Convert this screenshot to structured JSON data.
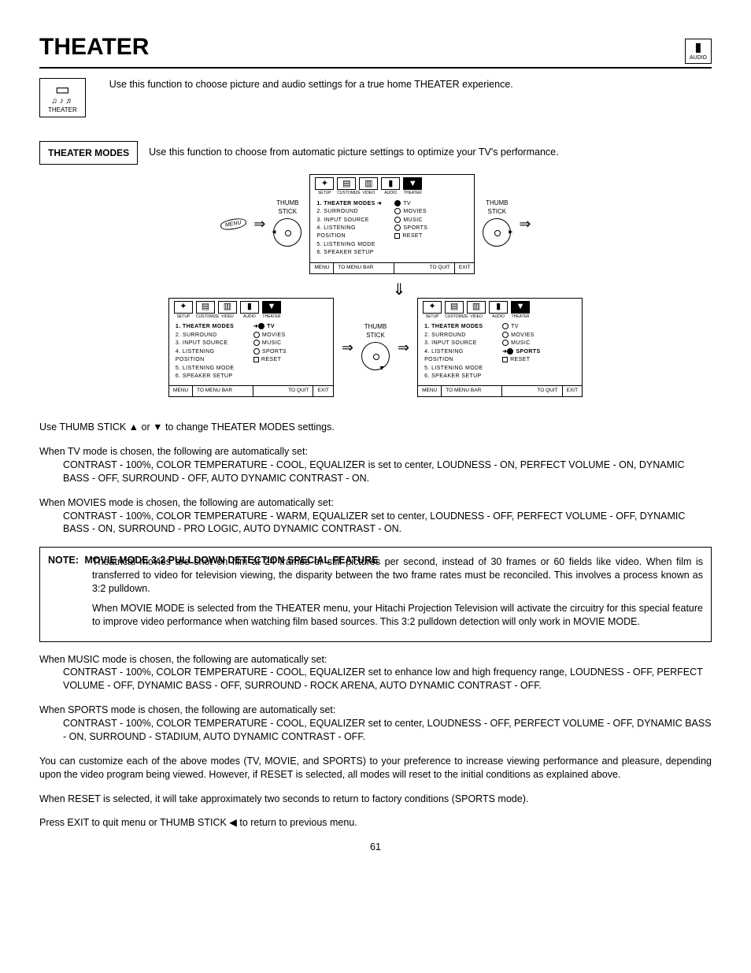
{
  "title": "THEATER",
  "audio_label": "AUDIO",
  "icon_label": "THEATER",
  "intro_text": "Use this function to choose picture and audio settings for a true home THEATER experience.",
  "modes_label": "THEATER MODES",
  "modes_text": "Use this function to choose from automatic picture settings to optimize your TV's performance.",
  "thumb_stick": "THUMB\nSTICK",
  "menu_btn": "MENU",
  "osd": {
    "icons": [
      "SETUP",
      "CUSTOMIZE",
      "VIDEO",
      "AUDIO",
      "THEATER"
    ],
    "items": [
      "1. THEATER MODES",
      "2. SURROUND",
      "3. INPUT SOURCE",
      "4. LISTENING",
      "    POSITION",
      "5. LISTENING MODE",
      "6. SPEAKER SETUP"
    ],
    "opts": [
      "TV",
      "MOVIES",
      "MUSIC",
      "SPORTS",
      "RESET"
    ],
    "foot_menu": "MENU",
    "foot_bar": "TO MENU BAR",
    "foot_quit": "TO QUIT",
    "foot_exit": "EXIT"
  },
  "body1": "Use THUMB STICK ▲ or ▼ to change THEATER MODES settings.",
  "tv_intro": "When TV mode is chosen, the following are automatically set:",
  "tv_detail": "CONTRAST - 100%, COLOR TEMPERATURE - COOL, EQUALIZER is set to center, LOUDNESS - ON, PERFECT VOLUME - ON, DYNAMIC BASS - OFF, SURROUND  - OFF, AUTO DYNAMIC CONTRAST - ON.",
  "movies_intro": "When MOVIES mode is chosen, the following are automatically set:",
  "movies_detail": "CONTRAST - 100%, COLOR TEMPERATURE - WARM, EQUALIZER set to center, LOUDNESS - OFF, PERFECT VOLUME - OFF, DYNAMIC BASS - ON, SURROUND - PRO LOGIC, AUTO DYNAMIC CONTRAST - ON.",
  "note_label": "NOTE:",
  "note_title": "MOVIE MODE 3:2 PULLDOWN DETECTION SPECIAL FEATURE",
  "note_p1": "Theatrical movies are shot on film at 24 frames or still pictures per second, instead of 30 frames or 60 fields like video.  When film is transferred to video for television viewing, the disparity between the two frame rates must be reconciled.  This involves a process known as 3:2 pulldown.",
  "note_p2": "When MOVIE MODE is selected from the THEATER menu, your Hitachi Projection Television will activate the circuitry for this special feature to improve video performance when watching film based sources.  This 3:2 pulldown detection will only work in MOVIE MODE.",
  "music_intro": "When MUSIC mode is chosen, the following are automatically set:",
  "music_detail": "CONTRAST - 100%, COLOR TEMPERATURE - COOL, EQUALIZER set to enhance low and high frequency range, LOUDNESS - OFF, PERFECT VOLUME - OFF, DYNAMIC BASS - OFF, SURROUND - ROCK ARENA, AUTO DYNAMIC CONTRAST - OFF.",
  "sports_intro": "When SPORTS mode is chosen, the following are automatically set:",
  "sports_detail": "CONTRAST - 100%, COLOR TEMPERATURE - COOL, EQUALIZER set to center, LOUDNESS - OFF, PERFECT VOLUME - OFF, DYNAMIC BASS - ON, SURROUND - STADIUM, AUTO DYNAMIC CONTRAST - OFF.",
  "customize": "You can customize each of the above modes (TV, MOVIE, and SPORTS) to your preference to increase viewing performance and pleasure, depending upon the video program being viewed. However, if RESET is selected, all modes will reset to the initial conditions as explained above.",
  "reset": "When RESET is selected, it will take approximately two seconds to return to factory conditions (SPORTS mode).",
  "exit": "Press EXIT to quit menu or THUMB STICK ◀ to return to previous menu.",
  "page": "61"
}
